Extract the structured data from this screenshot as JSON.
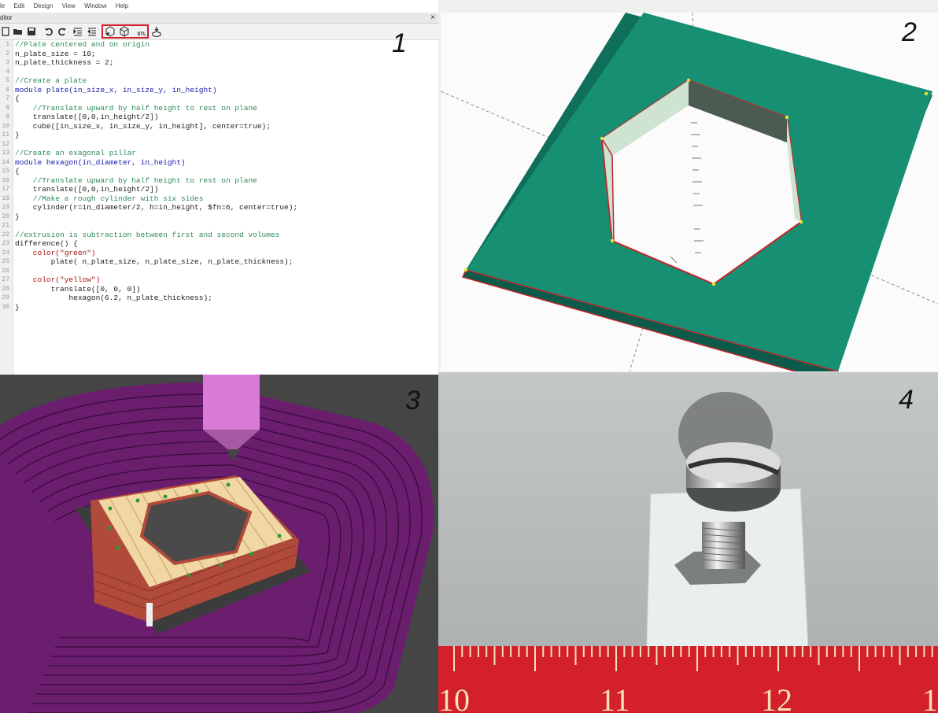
{
  "editor": {
    "menu": [
      "le",
      "Edit",
      "Design",
      "View",
      "Window",
      "Help"
    ],
    "title": "ditor",
    "close_glyph": "×",
    "toolbar_icons": [
      "new-file-icon",
      "open-file-icon",
      "save-icon",
      "undo-icon",
      "redo-icon",
      "indent-icon",
      "unindent-icon",
      "preview-icon",
      "render-icon",
      "export-stl-icon",
      "send-to-print-icon"
    ],
    "stl_label": "STL",
    "lines": [
      {
        "n": "1",
        "t": "//Plate centered and on origin",
        "k": "comment"
      },
      {
        "n": "2",
        "t": "n_plate_size = 10;",
        "k": "plain"
      },
      {
        "n": "3",
        "t": "n_plate_thickness = 2;",
        "k": "plain"
      },
      {
        "n": "4",
        "t": "",
        "k": "plain"
      },
      {
        "n": "5",
        "t": "//Create a plate",
        "k": "comment"
      },
      {
        "n": "6",
        "t": "module plate(in_size_x, in_size_y, in_height)",
        "k": "kw"
      },
      {
        "n": "7",
        "t": "{",
        "k": "plain"
      },
      {
        "n": "8",
        "t": "    //Translate upward by half height to rest on plane",
        "k": "comment"
      },
      {
        "n": "9",
        "t": "    translate([0,0,in_height/2])",
        "k": "plain"
      },
      {
        "n": "10",
        "t": "    cube([in_size_x, in_size_y, in_height], center=true);",
        "k": "plain"
      },
      {
        "n": "11",
        "t": "}",
        "k": "plain"
      },
      {
        "n": "12",
        "t": "",
        "k": "plain"
      },
      {
        "n": "13",
        "t": "//Create an exagonal pillar",
        "k": "comment"
      },
      {
        "n": "14",
        "t": "module hexagon(in_diameter, in_height)",
        "k": "kw"
      },
      {
        "n": "15",
        "t": "{",
        "k": "plain"
      },
      {
        "n": "16",
        "t": "    //Translate upward by half height to rest on plane",
        "k": "comment"
      },
      {
        "n": "17",
        "t": "    translate([0,0,in_height/2])",
        "k": "plain"
      },
      {
        "n": "18",
        "t": "    //Make a rough cylinder with six sides",
        "k": "comment"
      },
      {
        "n": "19",
        "t": "    cylinder(r=in_diameter/2, h=in_height, $fn=6, center=true);",
        "k": "plain"
      },
      {
        "n": "20",
        "t": "}",
        "k": "plain"
      },
      {
        "n": "21",
        "t": "",
        "k": "plain"
      },
      {
        "n": "22",
        "t": "//extrusion is subtraction between first and second volumes",
        "k": "comment"
      },
      {
        "n": "23",
        "t": "difference() {",
        "k": "plain"
      },
      {
        "n": "24",
        "t": "    color(\"green\")",
        "k": "str"
      },
      {
        "n": "25",
        "t": "        plate( n_plate_size, n_plate_size, n_plate_thickness);",
        "k": "plain"
      },
      {
        "n": "26",
        "t": "",
        "k": "plain"
      },
      {
        "n": "27",
        "t": "    color(\"yellow\")",
        "k": "str"
      },
      {
        "n": "28",
        "t": "        translate([0, 0, 0])",
        "k": "plain"
      },
      {
        "n": "29",
        "t": "            hexagon(6.2, n_plate_thickness);",
        "k": "plain"
      },
      {
        "n": "30",
        "t": "}",
        "k": "plain"
      }
    ]
  },
  "panels": {
    "p1": "1",
    "p2": "2",
    "p3": "3",
    "p4": "4"
  },
  "ruler": {
    "labels": [
      "10",
      "11",
      "12",
      "1"
    ]
  },
  "colors": {
    "plate_green": "#168f73",
    "edge_red": "#c0262c",
    "bed_purple": "#6b1d6e",
    "wall_brick": "#b04a3a",
    "infill_cream": "#f1d7a4",
    "nozzle_pink": "#d77bd6",
    "ruler_red": "#d3202a",
    "highlight_red": "#d0202c"
  }
}
